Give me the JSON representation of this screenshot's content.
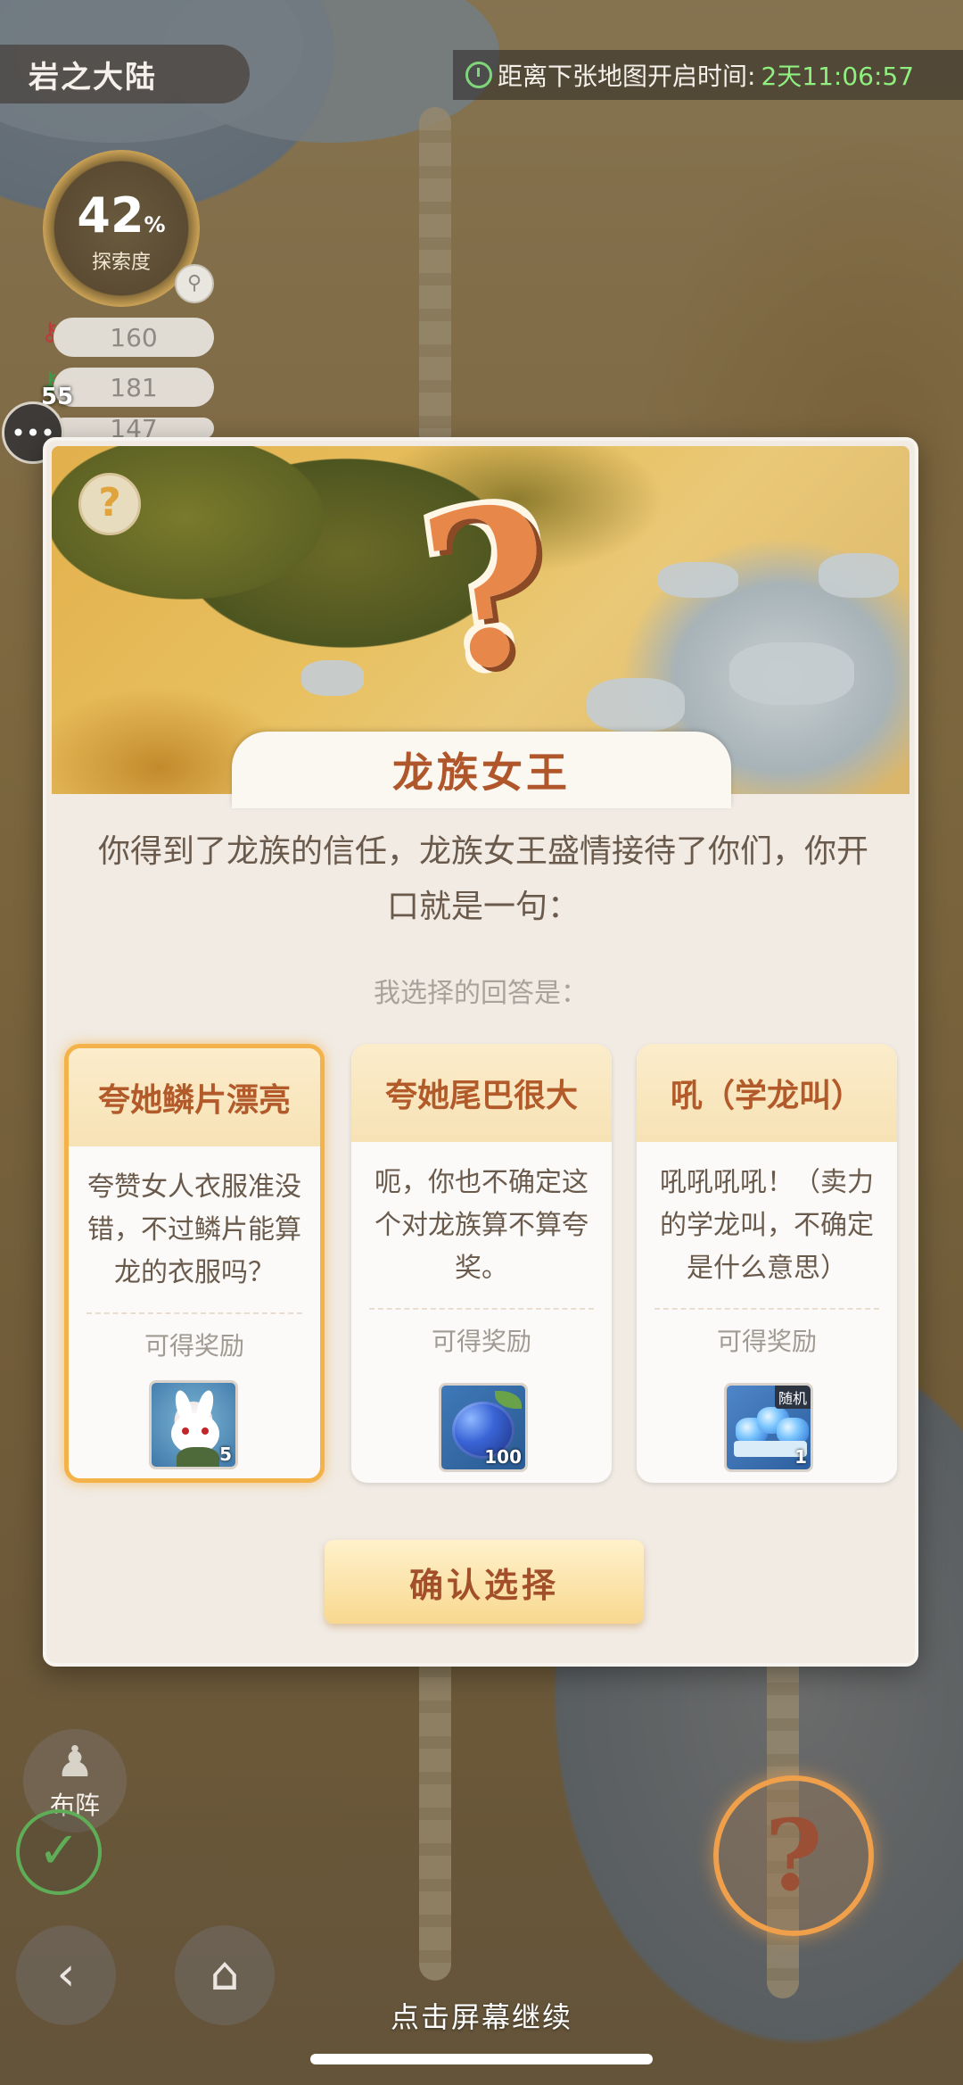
{
  "hud": {
    "region_title": "岩之大陆",
    "timer_label": "距离下张地图开启时间:",
    "timer_value": "2天11:06:57",
    "explore_percent": "42",
    "explore_percent_unit": "%",
    "explore_label": "探索度",
    "stats": [
      "160",
      "181",
      "147"
    ],
    "chat_badge": "55"
  },
  "dialog": {
    "title": "龙族女王",
    "story": "你得到了龙族的信任，龙族女王盛情接待了你们，你开口就是一句：",
    "prompt": "我选择的回答是：",
    "choices": [
      {
        "title": "夸她鳞片漂亮",
        "desc": "夸赞女人衣服准没错，不过鳞片能算龙的衣服吗？",
        "reward_label": "可得奖励",
        "reward_count": "5",
        "reward_icon": "bunny-pet-icon",
        "selected": true
      },
      {
        "title": "夸她尾巴很大",
        "desc": "呃，你也不确定这个对龙族算不算夸奖。",
        "reward_label": "可得奖励",
        "reward_count": "100",
        "reward_icon": "blue-berry-icon",
        "selected": false
      },
      {
        "title": "吼（学龙叫）",
        "desc": "吼吼吼吼！（卖力的学龙叫，不确定是什么意思）",
        "reward_label": "可得奖励",
        "reward_count": "1",
        "reward_tag": "随机",
        "reward_icon": "gem-chest-icon",
        "selected": false
      }
    ],
    "confirm_label": "确认选择"
  },
  "bottom": {
    "formation_label": "布阵",
    "continue_text": "点击屏幕继续"
  },
  "colors": {
    "accent": "#b0562b",
    "selected_border": "#f3b34a",
    "timer_green": "#8ff07f"
  }
}
